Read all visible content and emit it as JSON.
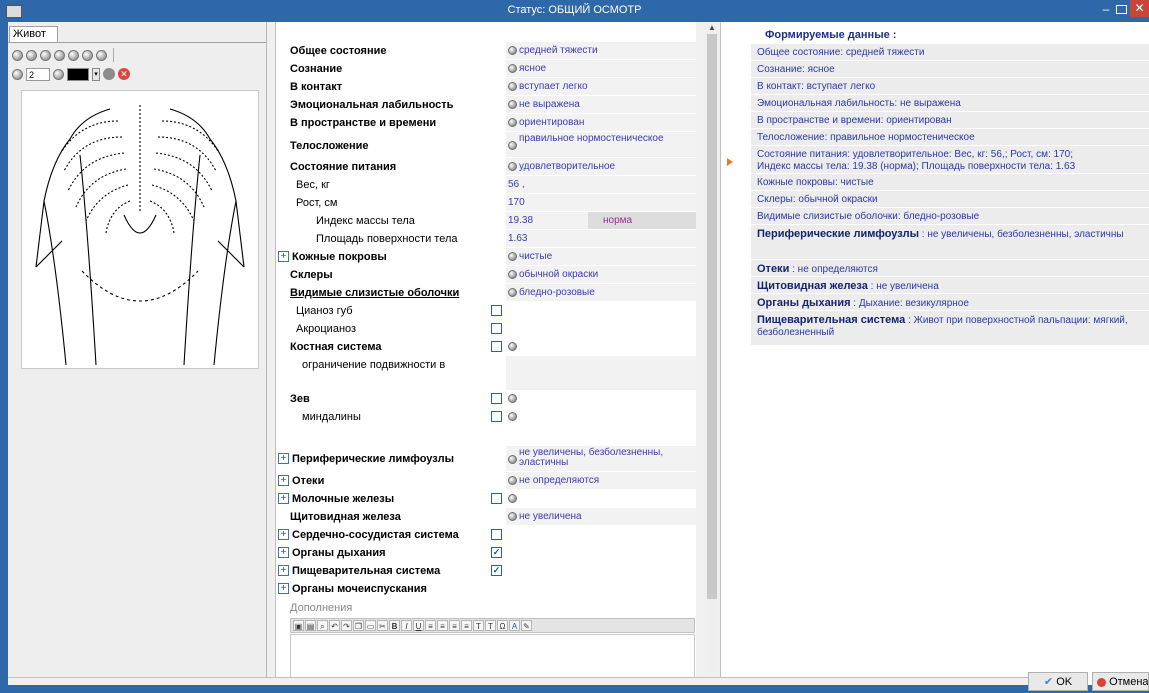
{
  "window": {
    "title": "Статус: ОБЩИЙ ОСМОТР"
  },
  "left_panel": {
    "tab": "Живот",
    "pen_size": "2",
    "tool_icons": [
      "pen-icon",
      "circle-tool-icon",
      "circle-tool-icon",
      "circle-tool-icon",
      "circle-tool-icon",
      "circle-tool-icon",
      "circle-tool-icon"
    ]
  },
  "form": {
    "rows": [
      {
        "label": "Общее состояние",
        "value": "средней тяжести"
      },
      {
        "label": "Сознание",
        "value": "ясное"
      },
      {
        "label": "В контакт",
        "value": "вступает легко"
      },
      {
        "label": "Эмоциональная лабильность",
        "value": "не выражена"
      },
      {
        "label": "В пространстве и времени",
        "value": "ориентирован"
      },
      {
        "label": "Телосложение",
        "value": "правильное нормостеническое"
      },
      {
        "label": "Состояние питания",
        "value": "удовлетворительное"
      },
      {
        "label": "Вес, кг",
        "value": "56 ,"
      },
      {
        "label": "Рост, см",
        "value": "170"
      },
      {
        "label": "Индекс массы тела",
        "value": "19.38",
        "extra": "норма"
      },
      {
        "label": "Площадь поверхности тела",
        "value": "1.63"
      },
      {
        "label": "Кожные покровы",
        "value": "чистые"
      },
      {
        "label": "Склеры",
        "value": "обычной окраски"
      },
      {
        "label": "Видимые слизистые оболочки",
        "value": "бледно-розовые"
      },
      {
        "label": "Цианоз губ"
      },
      {
        "label": "Акроцианоз"
      },
      {
        "label": "Костная система"
      },
      {
        "label": "ограничение подвижности в"
      },
      {
        "label": "Зев"
      },
      {
        "label": "миндалины"
      },
      {
        "label": "Периферические лимфоузлы",
        "value": "не увеличены, безболезненны, эластичны"
      },
      {
        "label": "Отеки",
        "value": "не определяются"
      },
      {
        "label": "Молочные железы"
      },
      {
        "label": "Щитовидная железа",
        "value": "не увеличена"
      },
      {
        "label": "Сердечно-сосудистая система"
      },
      {
        "label": "Органы дыхания"
      },
      {
        "label": "Пищеварительная система"
      },
      {
        "label": "Органы мочеиспускания"
      }
    ],
    "additions_label": "Дополнения",
    "editor_tools": [
      "B",
      "I",
      "U",
      "≡",
      "≡",
      "≡",
      "≡",
      "T",
      "T",
      "Ω",
      "A"
    ]
  },
  "summary": {
    "heading": "Формируемые данные :",
    "items": [
      {
        "text": "Общее состояние: средней тяжести"
      },
      {
        "text": "Сознание: ясное"
      },
      {
        "text": "В контакт: вступает легко"
      },
      {
        "text": "Эмоциональная лабильность: не выражена"
      },
      {
        "text": "В пространстве и времени: ориентирован"
      },
      {
        "text": "Телосложение: правильное нормостеническое"
      },
      {
        "text": "Состояние питания: удовлетворительное: Вес, кг: 56,; Рост, см: 170;\n Индекс массы тела: 19.38 (норма); Площадь поверхности тела: 1.63"
      },
      {
        "text": "Кожные покровы: чистые"
      },
      {
        "text": "Склеры: обычной окраски"
      },
      {
        "text": "Видимые слизистые оболочки: бледно-розовые"
      },
      {
        "bold": "Периферические лимфоузлы",
        "text": " : не увеличены, безболезненны, эластичны"
      },
      {
        "bold": "Отеки",
        "text": " : не определяются"
      },
      {
        "bold": "Щитовидная железа",
        "text": " : не увеличена"
      },
      {
        "bold": "Органы дыхания",
        "text": " : Дыхание: везикулярное"
      },
      {
        "bold": "Пищеварительная система",
        "text": " : Живот при поверхностной пальпации: мягкий, безболезненный"
      }
    ]
  },
  "buttons": {
    "ok": "OK",
    "cancel": "Отмена"
  },
  "colors": {
    "titlebar": "#2f68a8",
    "value_text": "#3b3bb0",
    "summary_text": "#2a3aa5",
    "norm_text": "#9b2c9b",
    "close": "#c7453a"
  }
}
